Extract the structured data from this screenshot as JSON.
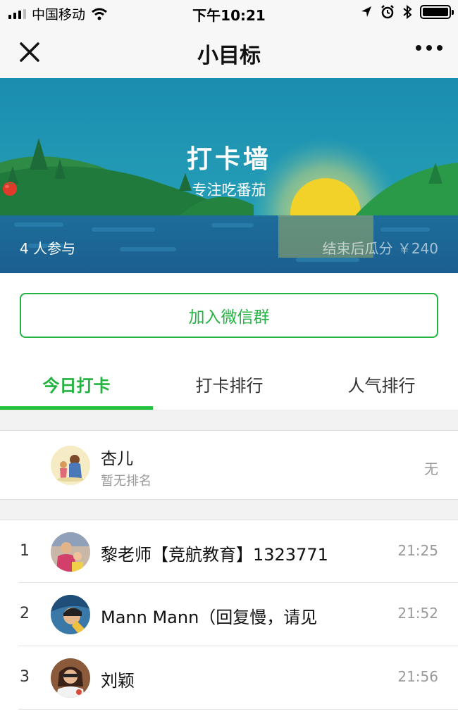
{
  "status_bar": {
    "carrier": "中国移动",
    "time": "下午10:21",
    "icons": [
      "signal-icon",
      "wifi-icon",
      "location-icon",
      "alarm-icon",
      "bluetooth-icon",
      "battery-icon"
    ]
  },
  "nav": {
    "title": "小目标",
    "close_icon": "close-icon",
    "more_icon": "more-icon"
  },
  "banner": {
    "title": "打卡墙",
    "subtitle": "专注吃番茄",
    "participants": "4 人参与",
    "reward": "结束后瓜分 ￥240"
  },
  "join_button": {
    "label": "加入微信群"
  },
  "tabs": [
    {
      "label": "今日打卡",
      "active": true
    },
    {
      "label": "打卡排行",
      "active": false
    },
    {
      "label": "人气排行",
      "active": false
    }
  ],
  "me": {
    "name": "杏儿",
    "rank_text": "暂无排名",
    "value": "无"
  },
  "list": [
    {
      "rank": "1",
      "name": "黎老师【竞航教育】1323771",
      "time": "21:25"
    },
    {
      "rank": "2",
      "name": "Mann Mann（回复慢，请见",
      "time": "21:52"
    },
    {
      "rank": "3",
      "name": "刘颖",
      "time": "21:56"
    }
  ],
  "colors": {
    "accent_green": "#22b33f",
    "banner_sky": "#1a8fb0",
    "muted_text": "#999999"
  }
}
